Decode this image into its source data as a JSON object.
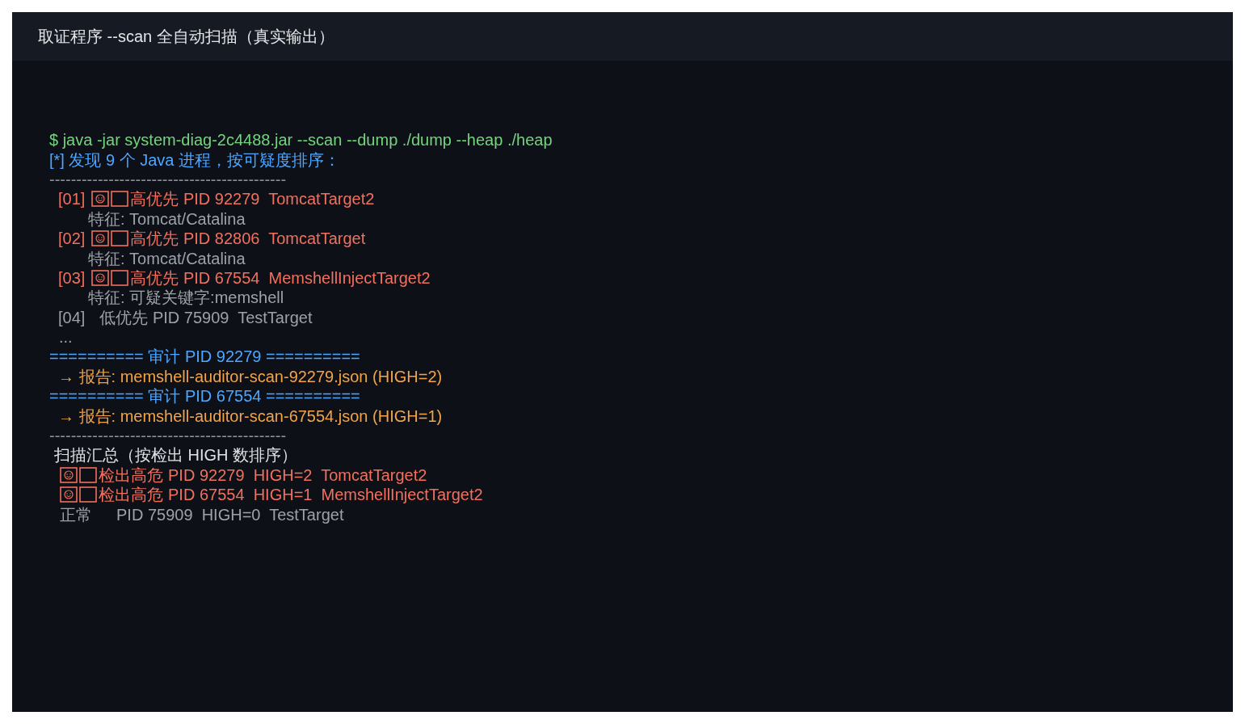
{
  "window": {
    "title": "取证程序 --scan 全自动扫描（真实输出）"
  },
  "lines": [
    {
      "kind": "command",
      "text": "$ java -jar system-diag-2c4488.jar --scan --dump ./dump --heap ./heap"
    },
    {
      "kind": "info",
      "text": "[*] 发现 9 个 Java 进程，按可疑度排序："
    },
    {
      "kind": "rule",
      "text": "--------------------------------------------"
    },
    {
      "kind": "process",
      "flagged": true,
      "index": "[01]",
      "text": "高优先 PID 92279  TomcatTarget2"
    },
    {
      "kind": "feature",
      "text": "特征: Tomcat/Catalina"
    },
    {
      "kind": "process",
      "flagged": true,
      "index": "[02]",
      "text": "高优先 PID 82806  TomcatTarget"
    },
    {
      "kind": "feature",
      "text": "特征: Tomcat/Catalina"
    },
    {
      "kind": "process",
      "flagged": true,
      "index": "[03]",
      "text": "高优先 PID 67554  MemshellInjectTarget2"
    },
    {
      "kind": "feature",
      "text": "特征: 可疑关键字:memshell"
    },
    {
      "kind": "process",
      "flagged": false,
      "index": "[04]",
      "text": "低优先 PID 75909  TestTarget"
    },
    {
      "kind": "ellipsis",
      "text": "..."
    },
    {
      "kind": "audit",
      "text": "========== 审计 PID 92279 =========="
    },
    {
      "kind": "report",
      "text": "→ 报告: memshell-auditor-scan-92279.json (HIGH=2)"
    },
    {
      "kind": "audit",
      "text": "========== 审计 PID 67554 =========="
    },
    {
      "kind": "report",
      "text": "→ 报告: memshell-auditor-scan-67554.json (HIGH=1)"
    },
    {
      "kind": "rule",
      "text": "--------------------------------------------"
    },
    {
      "kind": "summary-title",
      "text": "扫描汇总（按检出 HIGH 数排序）"
    },
    {
      "kind": "summary",
      "flagged": true,
      "status": "检出高危",
      "text": "PID 92279  HIGH=2  TomcatTarget2"
    },
    {
      "kind": "summary",
      "flagged": true,
      "status": "检出高危",
      "text": "PID 67554  HIGH=1  MemshellInjectTarget2"
    },
    {
      "kind": "summary",
      "flagged": false,
      "status": "正常",
      "text": "PID 75909  HIGH=0  TestTarget"
    }
  ]
}
